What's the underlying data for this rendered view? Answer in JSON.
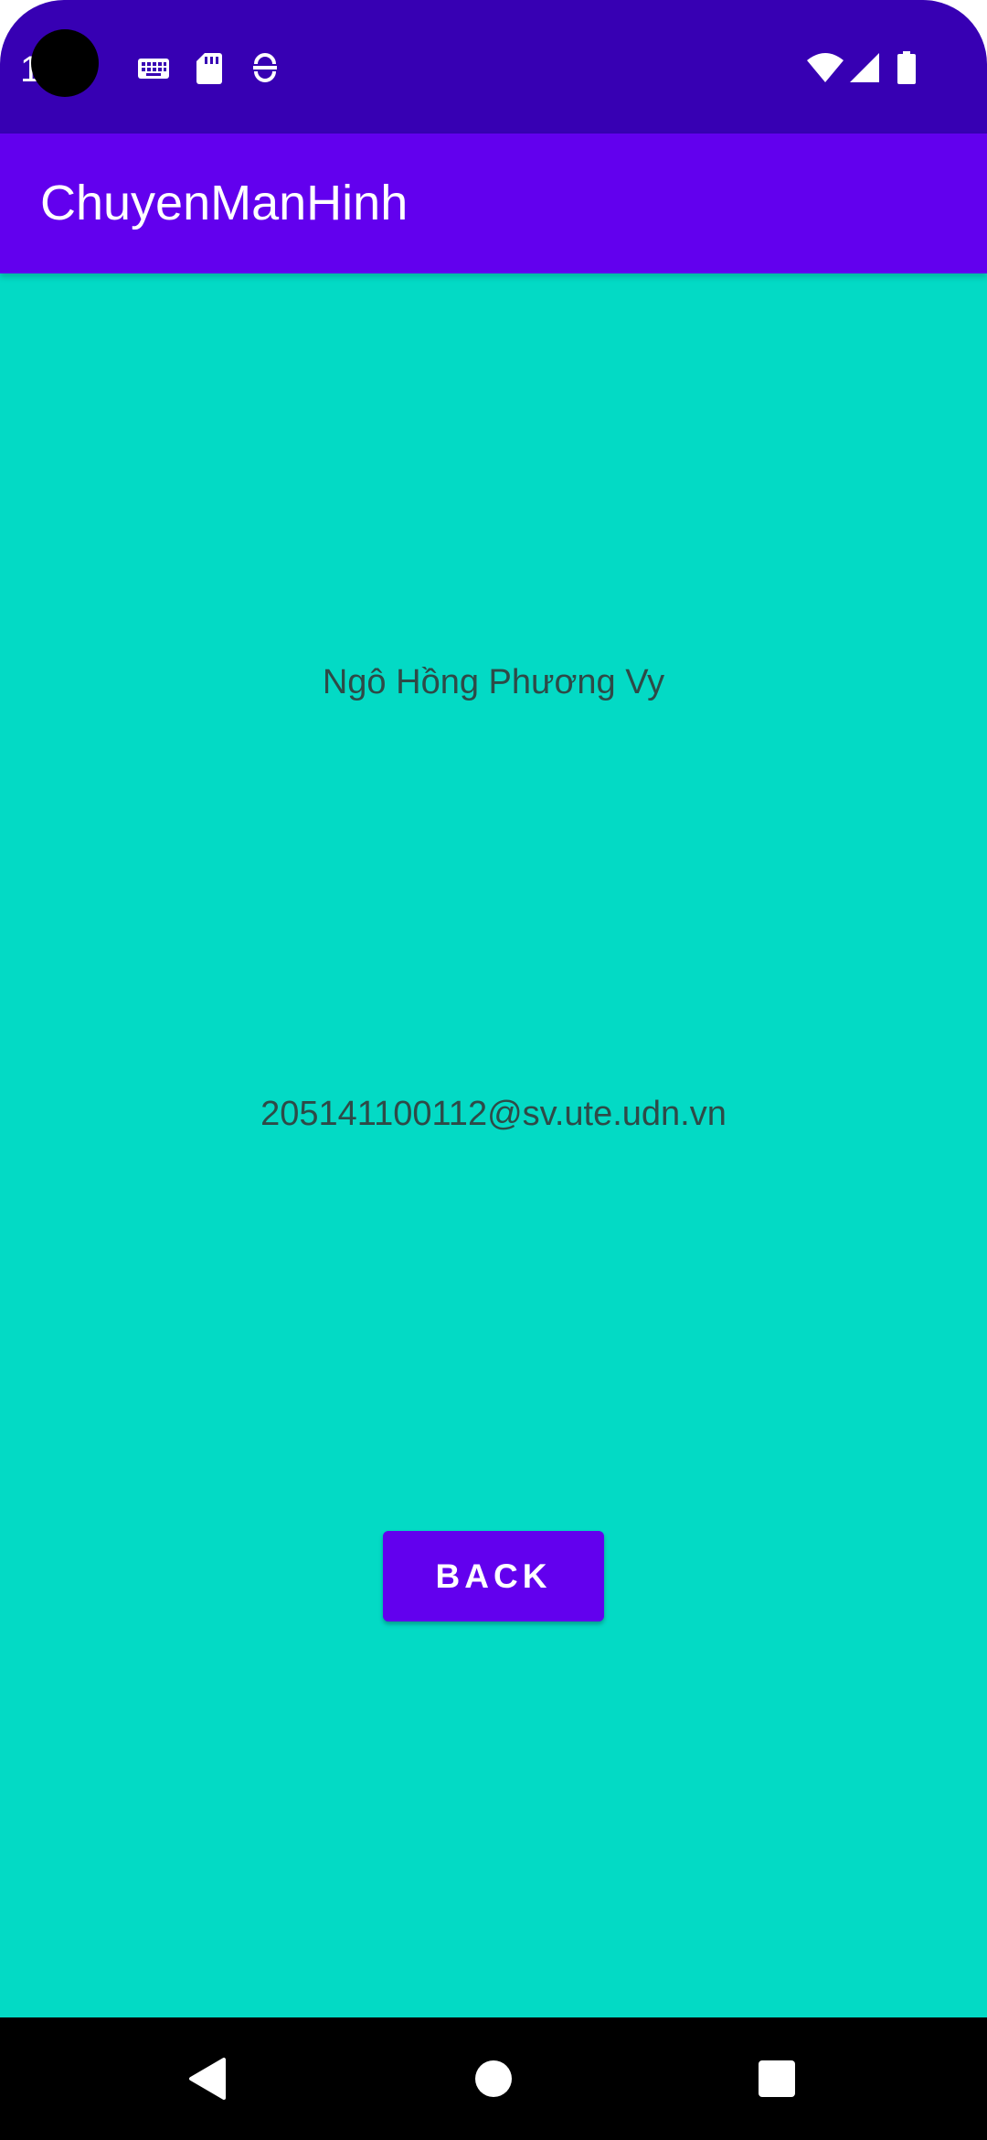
{
  "status_bar": {
    "time": "1 3",
    "icons": [
      "keyboard-icon",
      "sd-card-icon",
      "sync-icon",
      "wifi-icon",
      "signal-icon",
      "battery-icon"
    ],
    "background_color": "#3700b3"
  },
  "app_bar": {
    "title": "ChuyenManHinh",
    "background_color": "#6200ee"
  },
  "main": {
    "background_color": "#03dac5",
    "name": "Ngô Hồng Phương Vy",
    "email": "205141100112@sv.ute.udn.vn",
    "back_button_label": "BACK"
  },
  "nav_bar": {
    "icons": [
      "back-triangle-icon",
      "home-circle-icon",
      "recents-square-icon"
    ]
  }
}
